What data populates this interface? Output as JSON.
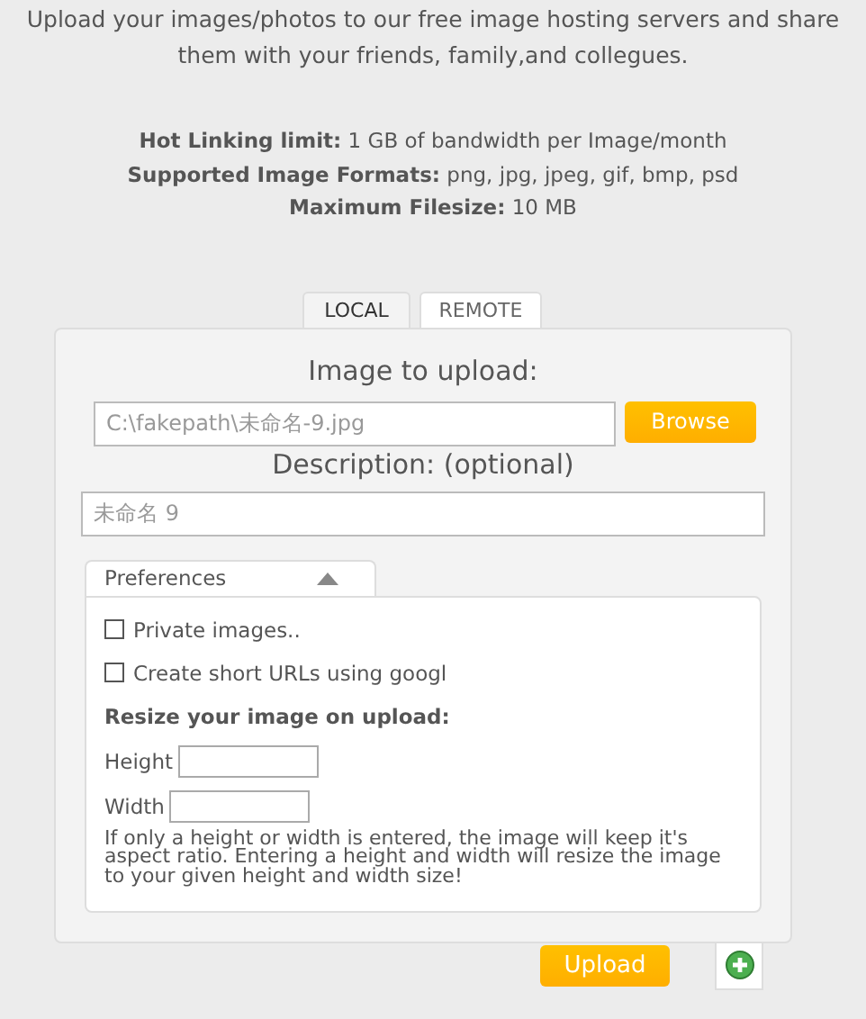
{
  "intro": "Upload your images/photos to our free image hosting servers and share them with your friends, family,and collegues.",
  "limits": [
    {
      "label": "Hot Linking limit:",
      "value": "1 GB of bandwidth per Image/month"
    },
    {
      "label": "Supported Image Formats:",
      "value": "png, jpg, jpeg, gif, bmp, psd"
    },
    {
      "label": "Maximum Filesize:",
      "value": "10 MB"
    }
  ],
  "tabs": [
    {
      "label": "LOCAL",
      "selected": true
    },
    {
      "label": "REMOTE",
      "selected": false
    }
  ],
  "form": {
    "file_label": "Image to upload:",
    "file_value": "C:\\fakepath\\未命名-9.jpg",
    "browse": "Browse",
    "description_label": "Description: (optional)",
    "description_value": "未命名 9"
  },
  "preferences": {
    "title": "Preferences",
    "expanded": true,
    "options": [
      {
        "label": "Private images..",
        "checked": false
      },
      {
        "label": "Create short URLs using googl",
        "checked": false
      }
    ],
    "resize_title": "Resize your image on upload:",
    "height_label": "Height",
    "width_label": "Width",
    "note": "If only a height or width is entered, the image will keep it's aspect ratio. Entering a height and width will resize the image to your given height and width size!"
  },
  "upload": "Upload"
}
